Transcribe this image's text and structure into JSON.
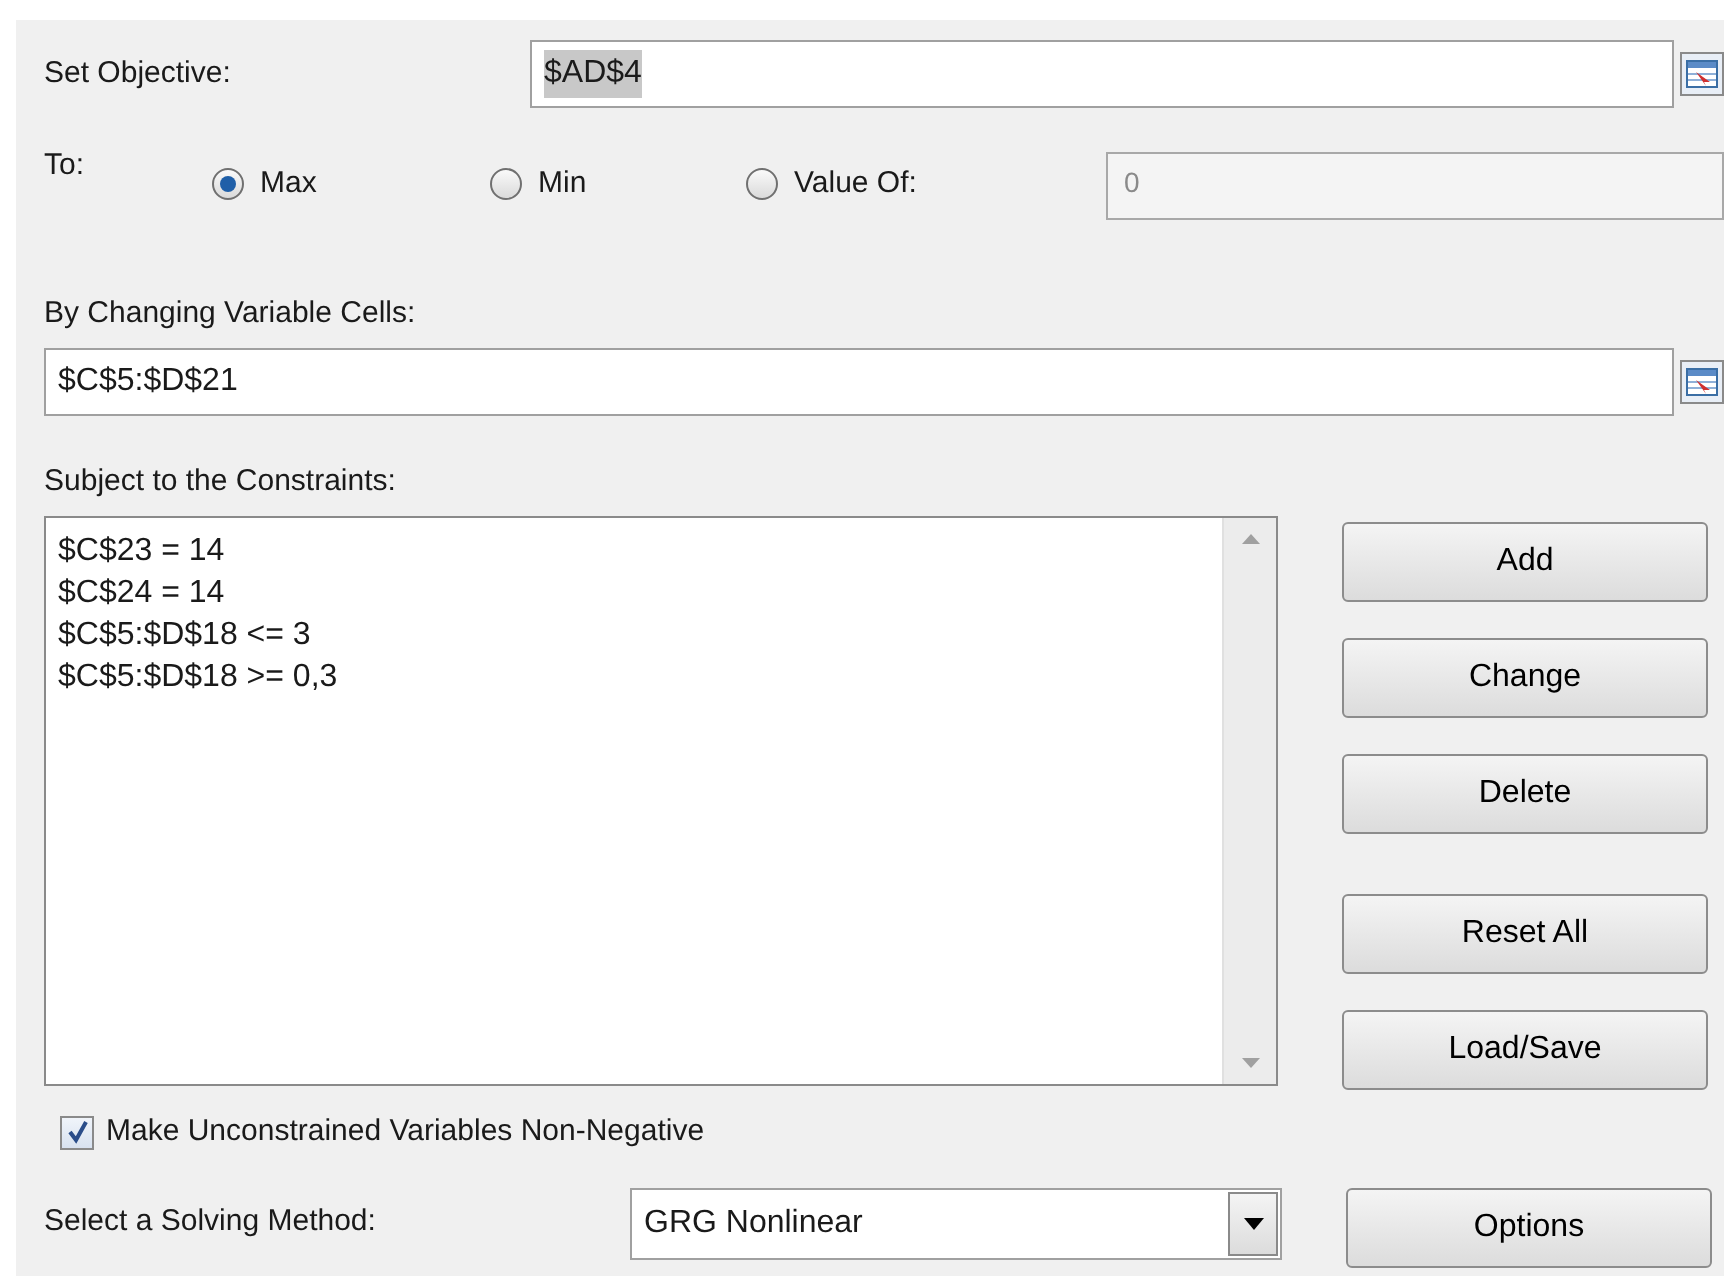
{
  "objective": {
    "label": "Set Objective:",
    "value": "$AD$4"
  },
  "to": {
    "label": "To:",
    "options": [
      {
        "label": "Max",
        "selected": true
      },
      {
        "label": "Min",
        "selected": false
      },
      {
        "label": "Value Of:",
        "selected": false
      }
    ],
    "value_of": "0"
  },
  "variable_cells": {
    "label": "By Changing Variable Cells:",
    "value": "$C$5:$D$21"
  },
  "constraints": {
    "label": "Subject to the Constraints:",
    "items": [
      "$C$23 = 14",
      "$C$24 = 14",
      "$C$5:$D$18 <= 3",
      "$C$5:$D$18 >= 0,3"
    ]
  },
  "buttons": [
    "Add",
    "Change",
    "Delete",
    "Reset All",
    "Load/Save"
  ],
  "non_negative": {
    "label": "Make Unconstrained Variables Non-Negative",
    "checked": true
  },
  "method": {
    "label": "Select a Solving Method:",
    "value": "GRG Nonlinear"
  },
  "options_button": "Options"
}
